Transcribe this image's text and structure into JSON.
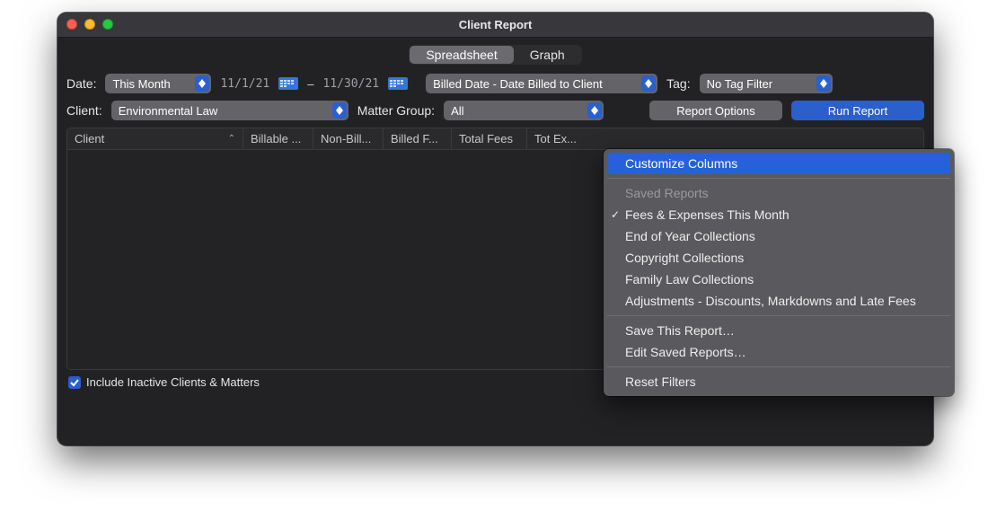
{
  "window": {
    "title": "Client Report"
  },
  "tabs": {
    "spreadsheet": "Spreadsheet",
    "graph": "Graph"
  },
  "filters": {
    "date_label": "Date:",
    "date_range_preset": "This Month",
    "date_start": "11/1/21",
    "date_sep": "–",
    "date_end": "11/30/21",
    "billed_source": "Billed Date - Date Billed to Client",
    "tag_label": "Tag:",
    "tag_value": "No Tag Filter",
    "client_label": "Client:",
    "client_value": "Environmental Law",
    "matter_label": "Matter Group:",
    "matter_value": "All"
  },
  "buttons": {
    "report_options": "Report Options",
    "run_report": "Run Report"
  },
  "columns": [
    "Client",
    "Billable ...",
    "Non-Bill...",
    "Billed F...",
    "Total Fees",
    "Tot Ex..."
  ],
  "footer": {
    "include_inactive": "Include Inactive Clients & Matters",
    "include_inactive_checked": true
  },
  "menu": {
    "customize": "Customize Columns",
    "section": "Saved Reports",
    "items": [
      {
        "label": "Fees & Expenses This Month",
        "checked": true
      },
      {
        "label": "End of Year Collections",
        "checked": false
      },
      {
        "label": "Copyright Collections",
        "checked": false
      },
      {
        "label": "Family Law Collections",
        "checked": false
      },
      {
        "label": "Adjustments - Discounts, Markdowns and Late Fees",
        "checked": false
      }
    ],
    "save_this": "Save This Report…",
    "edit_saved": "Edit Saved Reports…",
    "reset": "Reset Filters"
  }
}
